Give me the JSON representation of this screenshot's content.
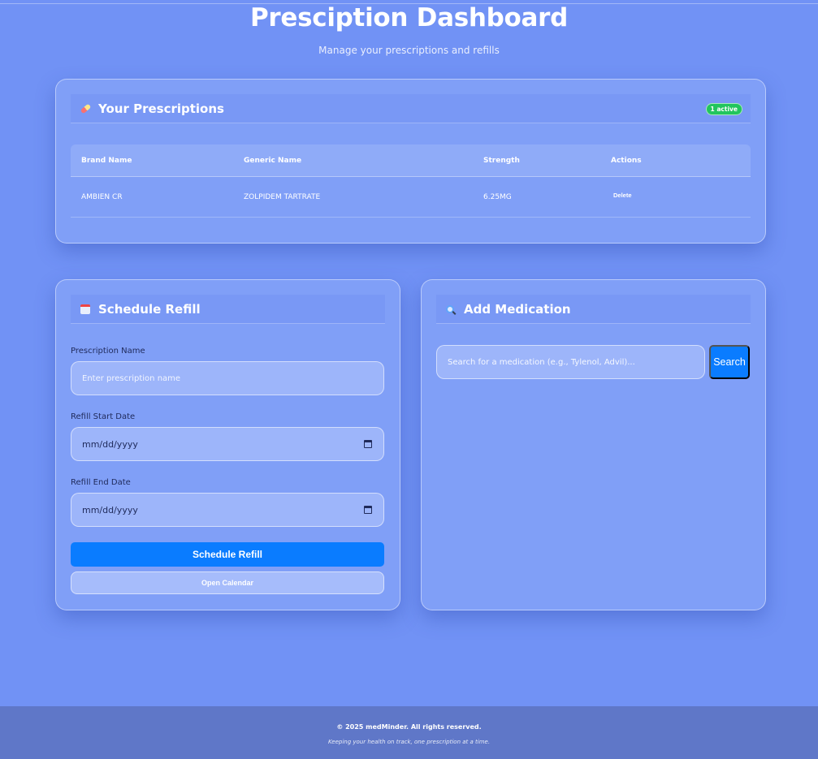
{
  "header": {
    "title": "Presciption Dashboard",
    "subtitle": "Manage your prescriptions and refills"
  },
  "prescriptions": {
    "icon": "pill-icon",
    "title": "Your Prescriptions",
    "badge": "1 active",
    "columns": [
      "Brand Name",
      "Generic Name",
      "Strength",
      "Actions"
    ],
    "rows": [
      {
        "brand": "AMBIEN CR",
        "generic": "ZOLPIDEM TARTRATE",
        "strength": "6.25MG",
        "action": "Delete"
      }
    ]
  },
  "refill": {
    "icon": "calendar-icon",
    "title": "Schedule Refill",
    "name_label": "Prescription Name",
    "name_placeholder": "Enter prescription name",
    "start_label": "Refill Start Date",
    "start_value": "mm/dd/yyyy",
    "end_label": "Refill End Date",
    "end_value": "mm/dd/yyyy",
    "submit_label": "Schedule Refill",
    "calendar_label": "Open Calendar"
  },
  "medication": {
    "icon": "magnifier-icon",
    "title": "Add Medication",
    "search_placeholder": "Search for a medication (e.g., Tylenol, Advil)...",
    "search_label": "Search"
  },
  "footer": {
    "copyright": "© 2025 medMinder. All rights reserved.",
    "tagline": "Keeping your health on track, one prescription at a time."
  },
  "colors": {
    "background": "#7192f5",
    "primary_button": "#0a7cff",
    "badge": "#22c55e",
    "footer": "#5f77c8"
  }
}
